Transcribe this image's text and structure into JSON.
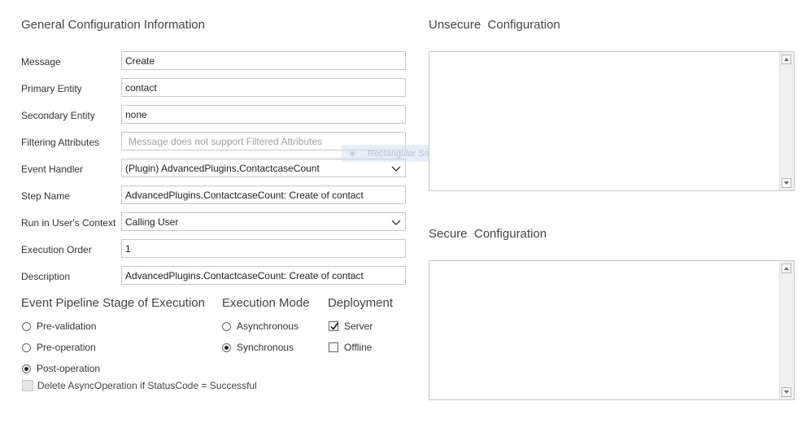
{
  "general": {
    "title": "General Configuration Information",
    "fields": [
      {
        "label": "Message",
        "value": "Create",
        "type": "text"
      },
      {
        "label": "Primary Entity",
        "value": "contact",
        "type": "text"
      },
      {
        "label": "Secondary Entity",
        "value": "none",
        "type": "text"
      },
      {
        "label": "Filtering Attributes",
        "value": "Message does not support Filtered Attributes",
        "type": "placeholder"
      },
      {
        "label": "Event Handler",
        "value": "(Plugin) AdvancedPlugins.ContactcaseCount",
        "type": "select"
      },
      {
        "label": "Step Name",
        "value": "AdvancedPlugins.ContactcaseCount: Create of contact",
        "type": "text"
      },
      {
        "label": "Run in User's Context",
        "value": "Calling User",
        "type": "select"
      },
      {
        "label": "Execution Order",
        "value": "1",
        "type": "text"
      },
      {
        "label": "Description",
        "value": "AdvancedPlugins.ContactcaseCount: Create of contact",
        "type": "text"
      }
    ]
  },
  "pipeline": {
    "title": "Event Pipeline Stage of Execution",
    "options": [
      {
        "label": "Pre-validation",
        "selected": false
      },
      {
        "label": "Pre-operation",
        "selected": false
      },
      {
        "label": "Post-operation",
        "selected": true
      }
    ],
    "delete_async_label": "Delete AsyncOperation if StatusCode = Successful",
    "delete_async_checked": false
  },
  "execution_mode": {
    "title": "Execution Mode",
    "options": [
      {
        "label": "Asynchronous",
        "selected": false
      },
      {
        "label": "Synchronous",
        "selected": true
      }
    ]
  },
  "deployment": {
    "title": "Deployment",
    "options": [
      {
        "label": "Server",
        "checked": true
      },
      {
        "label": "Offline",
        "checked": false
      }
    ]
  },
  "unsecure": {
    "title": "Unsecure  Configuration",
    "value": ""
  },
  "secure": {
    "title": "Secure  Configuration",
    "value": ""
  },
  "overlay": {
    "label": "Rectangular Snip"
  }
}
